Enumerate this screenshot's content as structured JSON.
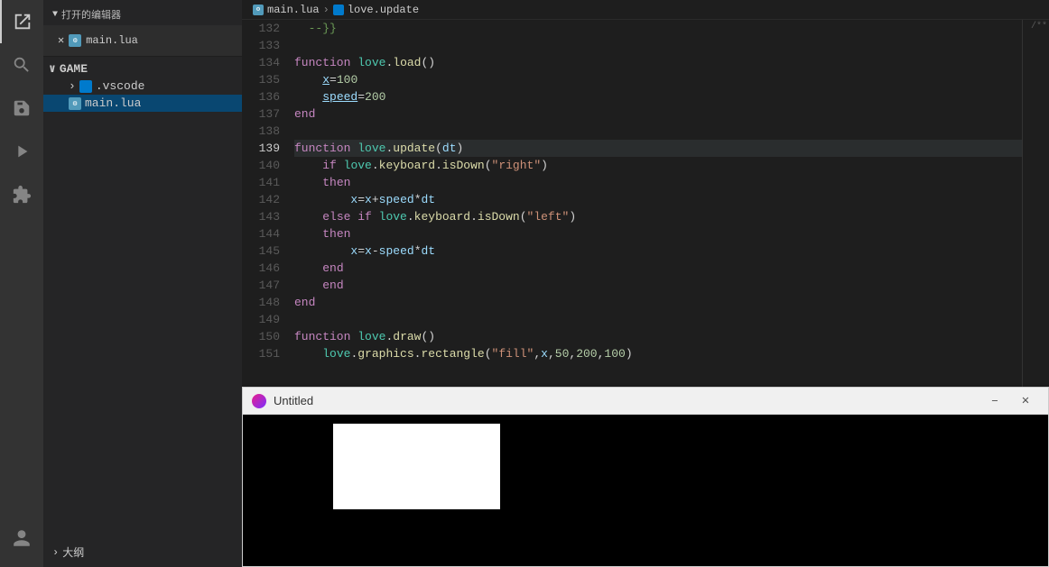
{
  "sidebar": {
    "open_editors_label": "打开的编辑器",
    "tab_file": "main.lua",
    "game_label": "GAME",
    "vscode_folder": ".vscode",
    "main_lua": "main.lua",
    "outline_label": "大纲"
  },
  "breadcrumb": {
    "file": "main.lua",
    "separator": ">",
    "symbol": "love.update"
  },
  "code": {
    "lines": [
      {
        "num": "132",
        "content": "  --}}"
      },
      {
        "num": "133",
        "content": ""
      },
      {
        "num": "134",
        "content": "function love.load()"
      },
      {
        "num": "135",
        "content": "    x=100"
      },
      {
        "num": "136",
        "content": "    speed=200"
      },
      {
        "num": "137",
        "content": "end"
      },
      {
        "num": "138",
        "content": ""
      },
      {
        "num": "139",
        "content": "function love.update(dt)"
      },
      {
        "num": "140",
        "content": "    if love.keyboard.isDown(\"right\")"
      },
      {
        "num": "141",
        "content": "    then"
      },
      {
        "num": "142",
        "content": "        x=x+speed*dt"
      },
      {
        "num": "143",
        "content": "    else if love.keyboard.isDown(\"left\")"
      },
      {
        "num": "144",
        "content": "    then"
      },
      {
        "num": "145",
        "content": "        x=x-speed*dt"
      },
      {
        "num": "146",
        "content": "    end"
      },
      {
        "num": "147",
        "content": "    end"
      },
      {
        "num": "148",
        "content": "end"
      },
      {
        "num": "149",
        "content": ""
      },
      {
        "num": "150",
        "content": "function love.draw()"
      },
      {
        "num": "151",
        "content": "    love.graphics.rectangle(\"fill\",x,50,200,100)"
      }
    ]
  },
  "popup": {
    "title": "Untitled",
    "minimize_label": "–",
    "close_label": "✕"
  },
  "icons": {
    "files": "🗂",
    "search": "🔍",
    "git": "⎇",
    "extensions": "⧉",
    "avatar": "👤"
  }
}
